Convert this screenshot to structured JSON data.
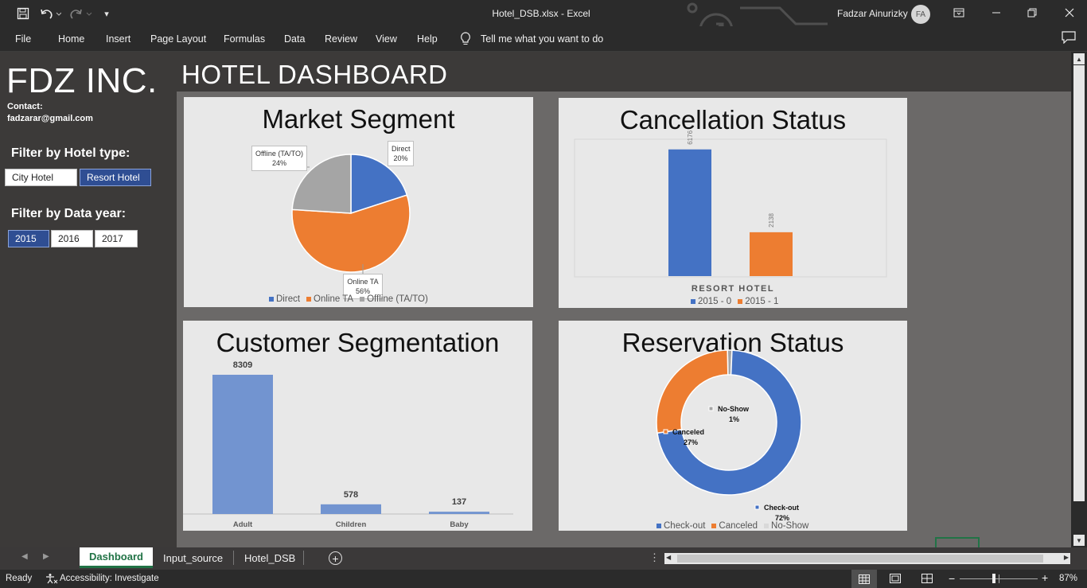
{
  "titlebar": {
    "doc_title": "Hotel_DSB.xlsx  -  Excel",
    "user_name": "Fadzar Ainurizky",
    "user_initials": "FA"
  },
  "ribbon": {
    "tabs": [
      "File",
      "Home",
      "Insert",
      "Page Layout",
      "Formulas",
      "Data",
      "Review",
      "View",
      "Help"
    ],
    "tell_me": "Tell me what you want to do"
  },
  "sidebar": {
    "brand": "FDZ INC.",
    "contact_label": "Contact:",
    "contact_email": "fadzarar@gmail.com",
    "filter_hotel_label": "Filter by Hotel type:",
    "hotel_types": [
      "City Hotel",
      "Resort Hotel"
    ],
    "hotel_selected": "Resort Hotel",
    "filter_year_label": "Filter by Data year:",
    "years": [
      "2015",
      "2016",
      "2017"
    ],
    "year_selected": "2015"
  },
  "dashboard": {
    "title": "HOTEL DASHBOARD"
  },
  "colors": {
    "blue": "#4472c4",
    "orange": "#ed7d31",
    "gray": "#a5a5a5",
    "light_blue": "#7294d0",
    "selected": "#2f4e93"
  },
  "chart_data": [
    {
      "type": "pie",
      "title": "Market Segment",
      "categories": [
        "Direct",
        "Online TA",
        "Offline (TA/TO)"
      ],
      "values": [
        20,
        56,
        24
      ],
      "data_labels": [
        "Direct\n20%",
        "Online TA\n56%",
        "Offline (TA/TO)\n24%"
      ],
      "colors": [
        "#4472c4",
        "#ed7d31",
        "#a5a5a5"
      ],
      "legend": "bottom"
    },
    {
      "type": "bar",
      "title": "Cancellation Status",
      "xlabel": "RESORT HOTEL",
      "series": [
        {
          "name": "2015 - 0",
          "values": [
            6176
          ]
        },
        {
          "name": "2015 - 1",
          "values": [
            2138
          ]
        }
      ],
      "colors": [
        "#4472c4",
        "#ed7d31"
      ],
      "legend": "bottom"
    },
    {
      "type": "bar",
      "title": "Customer Segmentation",
      "categories": [
        "Adult",
        "Children",
        "Baby"
      ],
      "values": [
        8309,
        578,
        137
      ],
      "color": "#7294d0"
    },
    {
      "type": "pie",
      "title": "Reservation Status",
      "categories": [
        "Check-out",
        "Canceled",
        "No-Show"
      ],
      "values": [
        72,
        27,
        1
      ],
      "data_labels": [
        "Check-out\n72%",
        "Canceled\n27%",
        "No-Show\n1%"
      ],
      "colors": [
        "#4472c4",
        "#ed7d31",
        "#a5a5a5"
      ],
      "legend": "bottom"
    }
  ],
  "sheet_tabs": {
    "tabs": [
      "Dashboard",
      "Input_source",
      "Hotel_DSB"
    ],
    "active": "Dashboard"
  },
  "statusbar": {
    "ready": "Ready",
    "accessibility": "Accessibility: Investigate",
    "zoom": "87%"
  }
}
